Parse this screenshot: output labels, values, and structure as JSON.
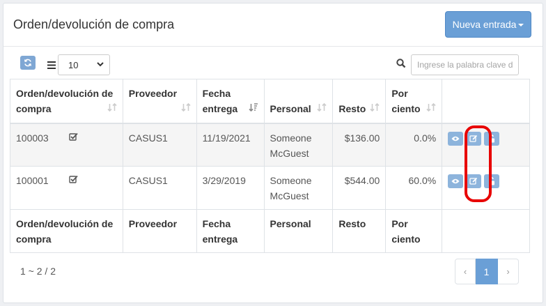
{
  "header": {
    "title": "Orden/devolución de compra",
    "new_button_label": "Nueva entrada"
  },
  "toolbar": {
    "page_size": "10",
    "search_placeholder": "Ingrese la palabra clave d"
  },
  "table": {
    "columns": [
      "Orden/devolución de compra",
      "Proveedor",
      "Fecha entrega",
      "Personal",
      "Resto",
      "Por ciento"
    ],
    "rows": [
      {
        "order": "100003",
        "supplier": "CASUS1",
        "date": "11/19/2021",
        "staff": "Someone McGuest",
        "rest": "$136.00",
        "percent": "0.0%"
      },
      {
        "order": "100001",
        "supplier": "CASUS1",
        "date": "3/29/2019",
        "staff": "Someone McGuest",
        "rest": "$544.00",
        "percent": "60.0%"
      }
    ],
    "footer": [
      "Orden/devolución de compra",
      "Proveedor",
      "Fecha entrega",
      "Personal",
      "Resto",
      "Por ciento"
    ]
  },
  "pagination": {
    "info": "1 ~ 2 / 2",
    "prev": "‹",
    "current": "1",
    "next": "›"
  },
  "icons": {
    "refresh": "refresh-icon",
    "menu": "list-icon",
    "search": "search-icon",
    "sort": "sort-icon",
    "check": "checked-box-icon",
    "view": "eye-icon",
    "edit": "edit-icon",
    "lock": "unlock-icon"
  },
  "colors": {
    "primary": "#6a9fd6",
    "action_button": "#8db4dc",
    "highlight": "#e80000"
  }
}
